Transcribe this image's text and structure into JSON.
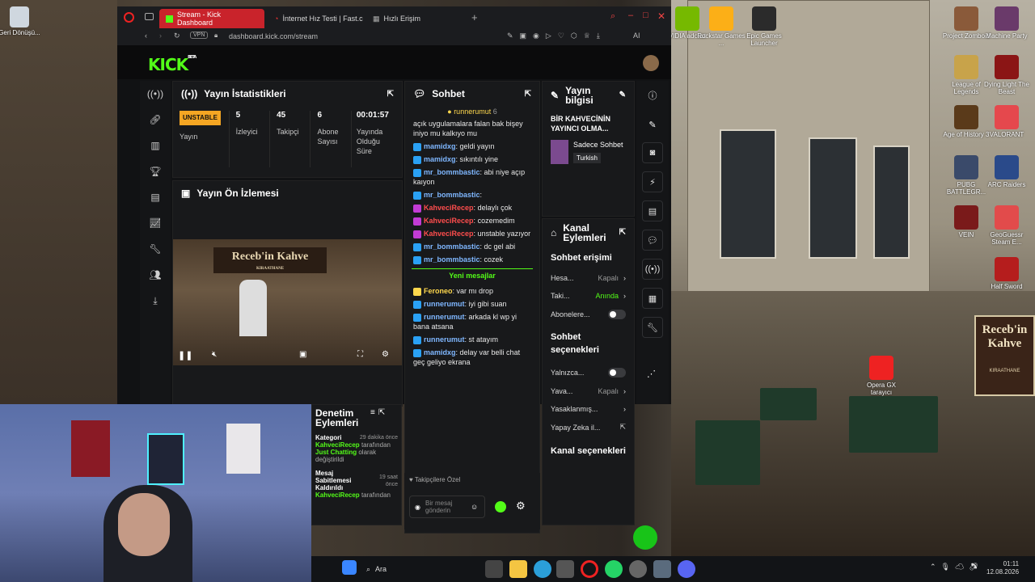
{
  "desktop": {
    "icons_left": [
      {
        "label": "Geri Dönüşü..."
      }
    ],
    "icons_right": [
      {
        "label": "VIDIA adcast"
      },
      {
        "label": "Rockstar Games ..."
      },
      {
        "label": "Epic Games Launcher"
      },
      {
        "label": "Project Zomboid"
      },
      {
        "label": "Machine Party"
      },
      {
        "label": "League of Legends"
      },
      {
        "label": "Dying Light The Beast"
      },
      {
        "label": "Age of History 3"
      },
      {
        "label": "VALORANT"
      },
      {
        "label": "PUBG BATTLEGR..."
      },
      {
        "label": "ARC Raiders"
      },
      {
        "label": "VEIN"
      },
      {
        "label": "GeoGuessr Steam E..."
      },
      {
        "label": "Half Sword"
      },
      {
        "label": "Opera GX tarayıcı"
      }
    ],
    "cafe_sign": "Receb'in Kahve",
    "cafe_sign_sub": "KIRAATHANE"
  },
  "browser": {
    "tabs": [
      {
        "label": "Stream - Kick Dashboard",
        "active": true
      },
      {
        "label": "İnternet Hız Testi | Fast.com",
        "active": false
      },
      {
        "label": "Hızlı Erişim",
        "active": false
      }
    ],
    "url": "dashboard.kick.com/stream",
    "vpn": "VPN",
    "ai": "AI"
  },
  "kick": {
    "logo": "KICK",
    "logo_sup": "BETA",
    "stats": {
      "title": "Yayın İstatistikleri",
      "status_badge": "UNSTABLE",
      "items": [
        {
          "value": "",
          "label": "Yayın"
        },
        {
          "value": "5",
          "label": "İzleyici"
        },
        {
          "value": "45",
          "label": "Takipçi"
        },
        {
          "value": "6",
          "label": "Abone Sayısı"
        },
        {
          "value": "00:01:57",
          "label": "Yayında Olduğu Süre"
        }
      ]
    },
    "preview": {
      "title": "Yayın Ön İzlemesi",
      "sign": "Receb'in Kahve",
      "sign_sub": "KIRAATHANE"
    },
    "moderation": {
      "title": "Denetim Eylemleri",
      "entries": [
        {
          "head": "Kategori",
          "time": "29 dakika önce",
          "user": "KahveciRecep",
          "action": "tarafından",
          "detail": "Just Chatting",
          "rest": "olarak değiştirildi"
        },
        {
          "head": "Mesaj Sabitlemesi Kaldırıldı",
          "time": "19 saat önce",
          "user": "KahveciRecep",
          "action": "tarafından",
          "detail": "",
          "rest": ""
        }
      ]
    },
    "chat": {
      "title": "Sohbet",
      "pinned_user": "runnerumut",
      "pinned_count": "6",
      "messages": [
        {
          "user": "",
          "cls": "",
          "text": "açık uygulamalara falan bak bişey iniyo mu kalkıyo mu"
        },
        {
          "user": "mamidxg",
          "cls": "u-blue",
          "text": "geldi yayın"
        },
        {
          "user": "mamidxg",
          "cls": "u-blue",
          "text": "sıkıntılı yine"
        },
        {
          "user": "mr_bommbastic",
          "cls": "u-blue",
          "text": "abi niye açıp kaıyon"
        },
        {
          "user": "mr_bommbastic",
          "cls": "u-blue",
          "text": ""
        },
        {
          "user": "KahveciRecep",
          "cls": "u-red",
          "text": "delaylı çok"
        },
        {
          "user": "KahveciRecep",
          "cls": "u-red",
          "text": "cozemedim"
        },
        {
          "user": "KahveciRecep",
          "cls": "u-red",
          "text": "unstable yazıyor"
        },
        {
          "user": "mr_bommbastic",
          "cls": "u-blue",
          "text": "dc gel abi"
        },
        {
          "user": "mr_bommbastic",
          "cls": "u-blue",
          "text": "cozek"
        }
      ],
      "new_messages": "Yeni mesajlar",
      "messages2": [
        {
          "user": "Feroneo",
          "cls": "u-yellow",
          "text": "var mı drop"
        },
        {
          "user": "runnerumut",
          "cls": "u-blue",
          "text": "iyi gibi suan"
        },
        {
          "user": "runnerumut",
          "cls": "u-blue",
          "text": "arkada kl wp yi bana atsana"
        },
        {
          "user": "runnerumut",
          "cls": "u-blue",
          "text": "st atayım"
        },
        {
          "user": "mamidxg",
          "cls": "u-blue",
          "text": "delay var belli chat geç geliyo ekrana"
        }
      ],
      "followers_only": "Takipçilere Özel",
      "input_placeholder": "Bir mesaj gönderin"
    },
    "stream_info": {
      "title": "Yayın bilgisi",
      "stream_title": "BİR KAHVECİNİN YAYINCI OLMA...",
      "category": "Sadece Sohbet",
      "language": "Turkish"
    },
    "channel_actions": {
      "title": "Kanal Eylemleri",
      "section1": "Sohbet erişimi",
      "rows1": [
        {
          "label": "Hesa...",
          "value": "Kapalı"
        },
        {
          "label": "Taki...",
          "value": "Anında"
        },
        {
          "label": "Abonelere...",
          "value": ""
        }
      ],
      "section2": "Sohbet seçenekleri",
      "rows2": [
        {
          "label": "Yalnızca...",
          "value": ""
        },
        {
          "label": "Yava...",
          "value": "Kapalı"
        },
        {
          "label": "Yasaklanmış...",
          "value": ""
        },
        {
          "label": "Yapay Zeka il...",
          "value": ""
        }
      ],
      "section3": "Kanal seçenekleri"
    }
  },
  "taskbar": {
    "search": "Ara",
    "time": "01:11",
    "date": "12.08.2026"
  },
  "colors": {
    "kick_green": "#53fc18",
    "opera_red": "#c9232b",
    "unstable": "#f5a623"
  }
}
